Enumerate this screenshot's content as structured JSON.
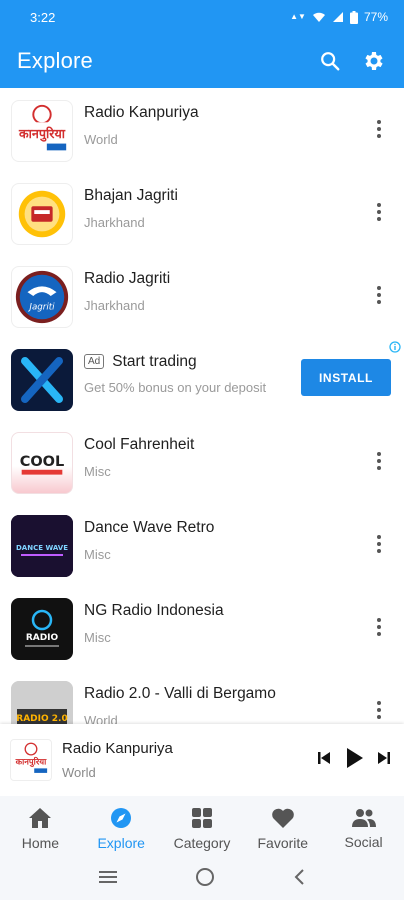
{
  "status": {
    "time": "3:22",
    "battery": "77%",
    "network": "VoLTE"
  },
  "appbar": {
    "title": "Explore",
    "color": "#2196F3"
  },
  "stations": [
    {
      "name": "Radio Kanpuriya",
      "sub": "World",
      "logo_text": "कानपुरिया"
    },
    {
      "name": "Bhajan Jagriti",
      "sub": "Jharkhand",
      "logo_text": ""
    },
    {
      "name": "Radio Jagriti",
      "sub": "Jharkhand",
      "logo_text": "Jagriti"
    },
    {
      "name": "Cool Fahrenheit",
      "sub": "Misc",
      "logo_text": "COOL"
    },
    {
      "name": "Dance Wave Retro",
      "sub": "Misc",
      "logo_text": "DANCE WAVE"
    },
    {
      "name": "NG Radio Indonesia",
      "sub": "Misc",
      "logo_text": "RADIO"
    },
    {
      "name": "Radio 2.0 - Valli di Bergamo",
      "sub": "World",
      "logo_text": "RADIO 2.0"
    }
  ],
  "ad": {
    "badge": "Ad",
    "title": "Start trading",
    "description": "Get 50% bonus on your deposit",
    "button": "INSTALL"
  },
  "player": {
    "name": "Radio Kanpuriya",
    "sub": "World"
  },
  "nav": [
    {
      "label": "Home",
      "icon": "home-icon"
    },
    {
      "label": "Explore",
      "icon": "compass-icon"
    },
    {
      "label": "Category",
      "icon": "grid-icon"
    },
    {
      "label": "Favorite",
      "icon": "heart-icon"
    },
    {
      "label": "Social",
      "icon": "people-icon"
    }
  ],
  "nav_active": "Explore",
  "accent_color": "#2196F3"
}
